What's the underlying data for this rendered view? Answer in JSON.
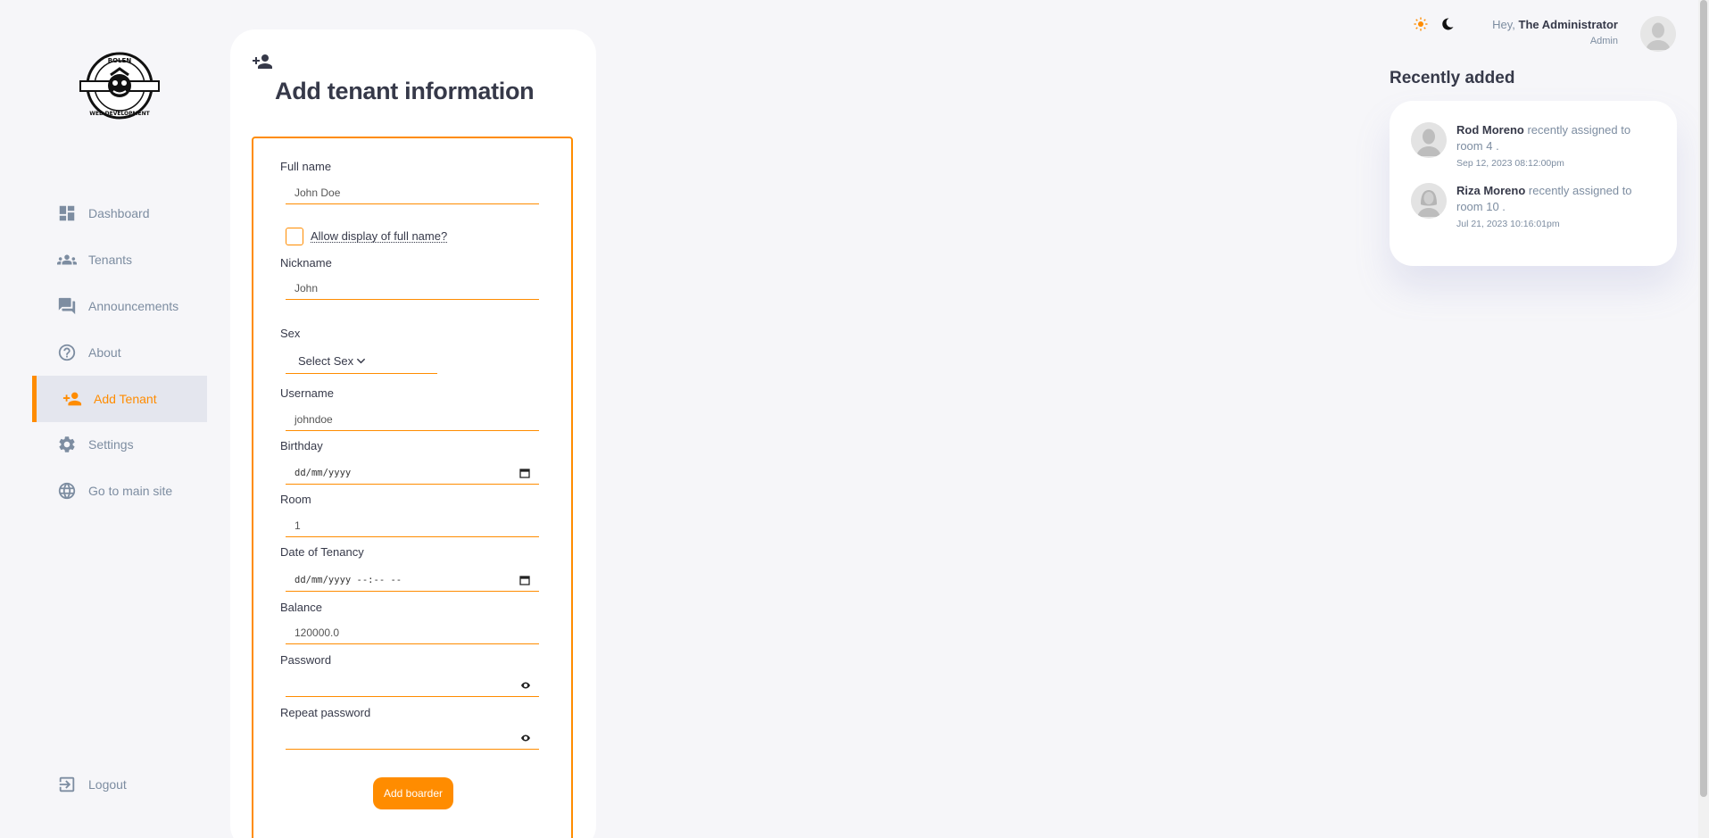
{
  "sidebar": {
    "logo_text": [
      "BOLEN",
      "WEB DEVELOPMENT"
    ],
    "items": [
      {
        "label": "Dashboard",
        "icon": "dashboard-icon"
      },
      {
        "label": "Tenants",
        "icon": "groups-icon"
      },
      {
        "label": "Announcements",
        "icon": "forum-icon"
      },
      {
        "label": "About",
        "icon": "help-icon"
      },
      {
        "label": "Add Tenant",
        "icon": "person-add-icon",
        "active": true
      },
      {
        "label": "Settings",
        "icon": "gear-icon"
      },
      {
        "label": "Go to main site",
        "icon": "globe-icon"
      }
    ],
    "logout_label": "Logout"
  },
  "form": {
    "title": "Add tenant information",
    "fullname_label": "Full name",
    "fullname_placeholder": "John Doe",
    "allow_display_label": "Allow display of full name?",
    "nickname_label": "Nickname",
    "nickname_placeholder": "John",
    "sex_label": "Sex",
    "sex_select": "Select Sex",
    "username_label": "Username",
    "username_placeholder": "johndoe",
    "birthday_label": "Birthday",
    "birthday_placeholder": "dd/mm/yyyy",
    "room_label": "Room",
    "room_value": "1",
    "tenancy_label": "Date of Tenancy",
    "tenancy_placeholder": "dd/mm/yyyy --:-- --",
    "balance_label": "Balance",
    "balance_value": "120000.0",
    "password_label": "Password",
    "repeat_password_label": "Repeat password",
    "submit_label": "Add boarder"
  },
  "header": {
    "greeting_prefix": "Hey,",
    "user_name": "The Administrator",
    "user_role": "Admin"
  },
  "recent": {
    "title": "Recently added",
    "updates": [
      {
        "name": "Rod Moreno",
        "text": " recently assigned to room 4 .",
        "time": "Sep 12, 2023 08:12:00pm",
        "avatar": "male-avatar"
      },
      {
        "name": "Riza Moreno",
        "text": " recently assigned to room 10 .",
        "time": "Jul 21, 2023 10:16:01pm",
        "avatar": "female-avatar"
      }
    ]
  },
  "colors": {
    "accent": "#ff8c00",
    "text": "#363949",
    "muted": "#7d8da1",
    "bg": "#f6f6f9"
  }
}
